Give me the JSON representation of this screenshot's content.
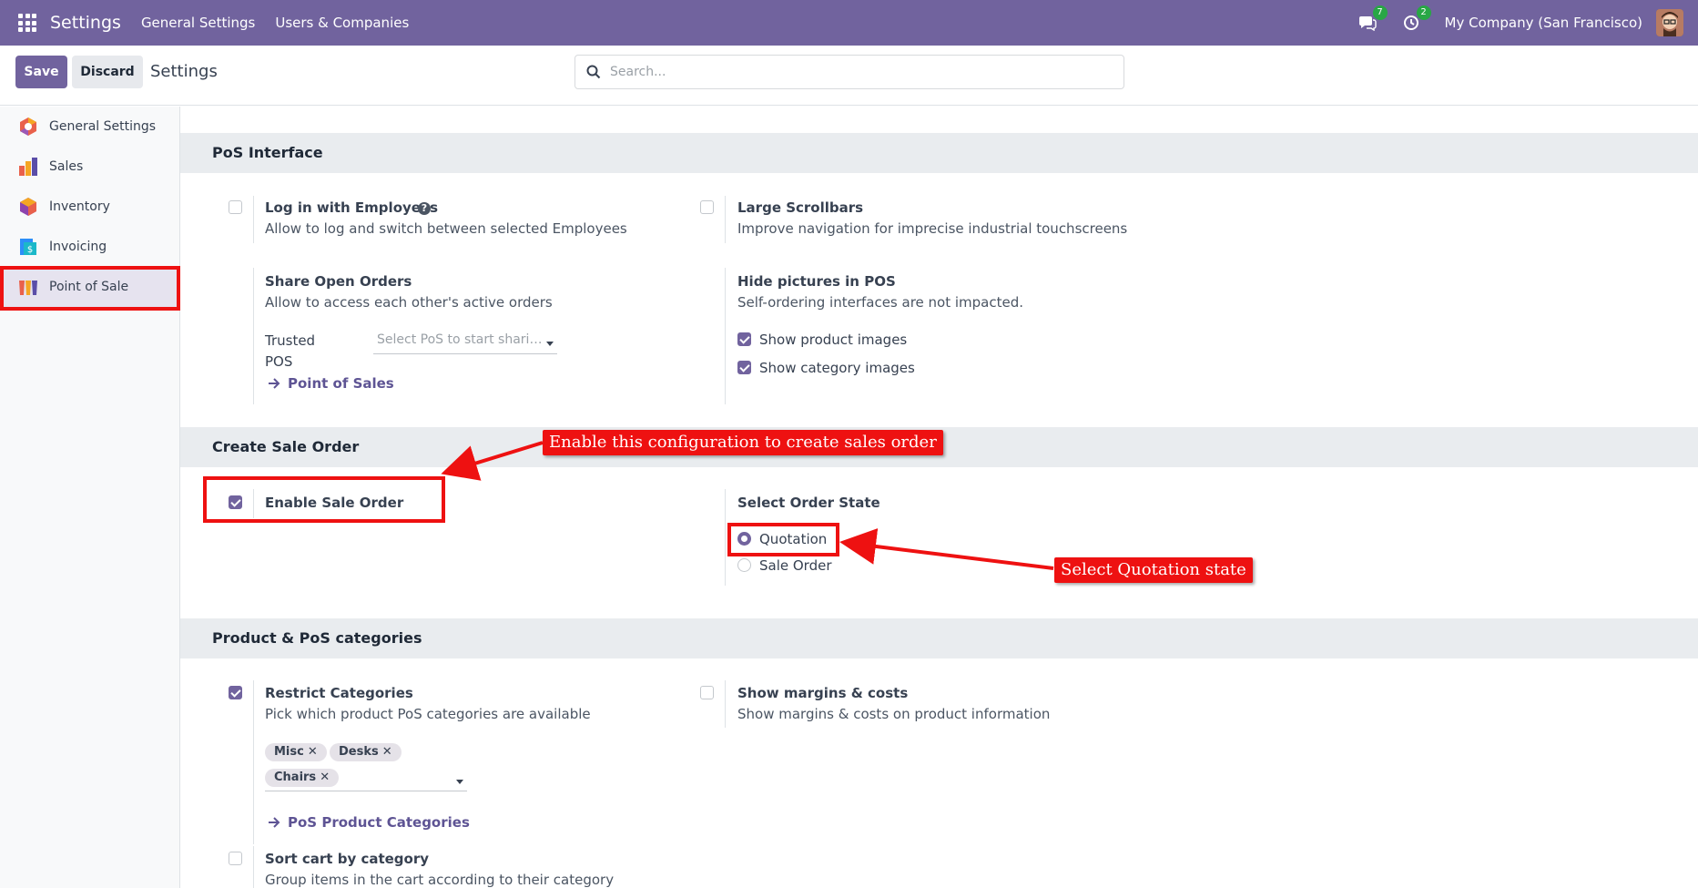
{
  "navbar": {
    "app_title": "Settings",
    "menu": [
      "General Settings",
      "Users & Companies"
    ],
    "messages_count": "7",
    "activities_count": "2",
    "company": "My Company (San Francisco)"
  },
  "control": {
    "save_label": "Save",
    "discard_label": "Discard",
    "title": "Settings",
    "search_placeholder": "Search..."
  },
  "sidebar": {
    "items": [
      {
        "label": "General Settings",
        "icon": "general-settings-icon"
      },
      {
        "label": "Sales",
        "icon": "sales-icon"
      },
      {
        "label": "Inventory",
        "icon": "inventory-icon"
      },
      {
        "label": "Invoicing",
        "icon": "invoicing-icon"
      },
      {
        "label": "Point of Sale",
        "icon": "point-of-sale-icon",
        "active": true
      }
    ]
  },
  "sections": {
    "pos_interface": {
      "title": "PoS Interface",
      "login_employees": {
        "title": "Log in with Employees",
        "desc": "Allow to log and switch between selected Employees",
        "checked": false
      },
      "large_scrollbars": {
        "title": "Large Scrollbars",
        "desc": "Improve navigation for imprecise industrial touchscreens",
        "checked": false
      },
      "share_orders": {
        "title": "Share Open Orders",
        "desc": "Allow to access each other's active orders",
        "trusted_label_1": "Trusted",
        "trusted_label_2": "POS",
        "trusted_placeholder": "Select PoS to start shari…",
        "link": "Point of Sales"
      },
      "hide_pictures": {
        "title": "Hide pictures in POS",
        "desc": "Self-ordering interfaces are not impacted.",
        "show_product_images": "Show product images",
        "show_category_images": "Show category images"
      }
    },
    "create_sale_order": {
      "title": "Create Sale Order",
      "enable_label": "Enable Sale Order",
      "state_title": "Select Order State",
      "state_options": [
        "Quotation",
        "Sale Order"
      ],
      "selected_state": "Quotation"
    },
    "product_categories": {
      "title": "Product & PoS categories",
      "restrict": {
        "title": "Restrict Categories",
        "desc": "Pick which product PoS categories are available",
        "tags": [
          "Misc",
          "Desks",
          "Chairs"
        ],
        "link": "PoS Product Categories"
      },
      "margins": {
        "title": "Show margins & costs",
        "desc": "Show margins & costs on product information"
      },
      "sort_cart": {
        "title": "Sort cart by category",
        "desc": "Group items in the cart according to their category"
      }
    }
  },
  "annotations": {
    "enable_callout": "Enable this configuration to create sales order",
    "quotation_callout": "Select Quotation state",
    "color": "#ee1111"
  }
}
